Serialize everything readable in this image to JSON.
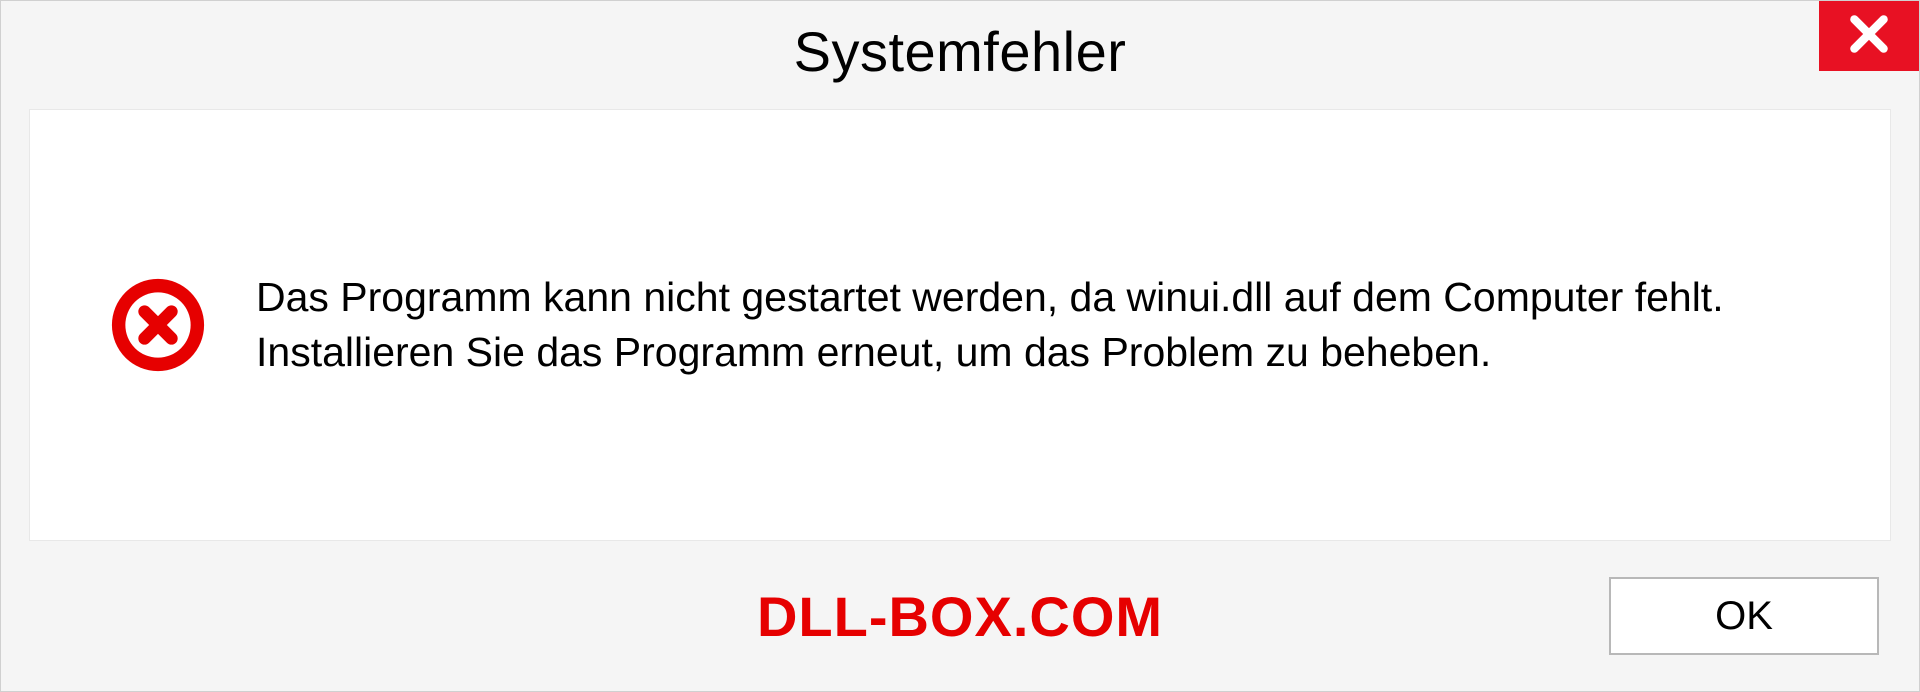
{
  "dialog": {
    "title": "Systemfehler",
    "message": "Das Programm kann nicht gestartet werden, da winui.dll auf dem Computer fehlt. Installieren Sie das Programm erneut, um das Problem zu beheben.",
    "ok_label": "OK"
  },
  "watermark": "DLL-BOX.COM",
  "colors": {
    "close_bg": "#e81123",
    "error_icon": "#e60000",
    "watermark": "#e60000"
  }
}
